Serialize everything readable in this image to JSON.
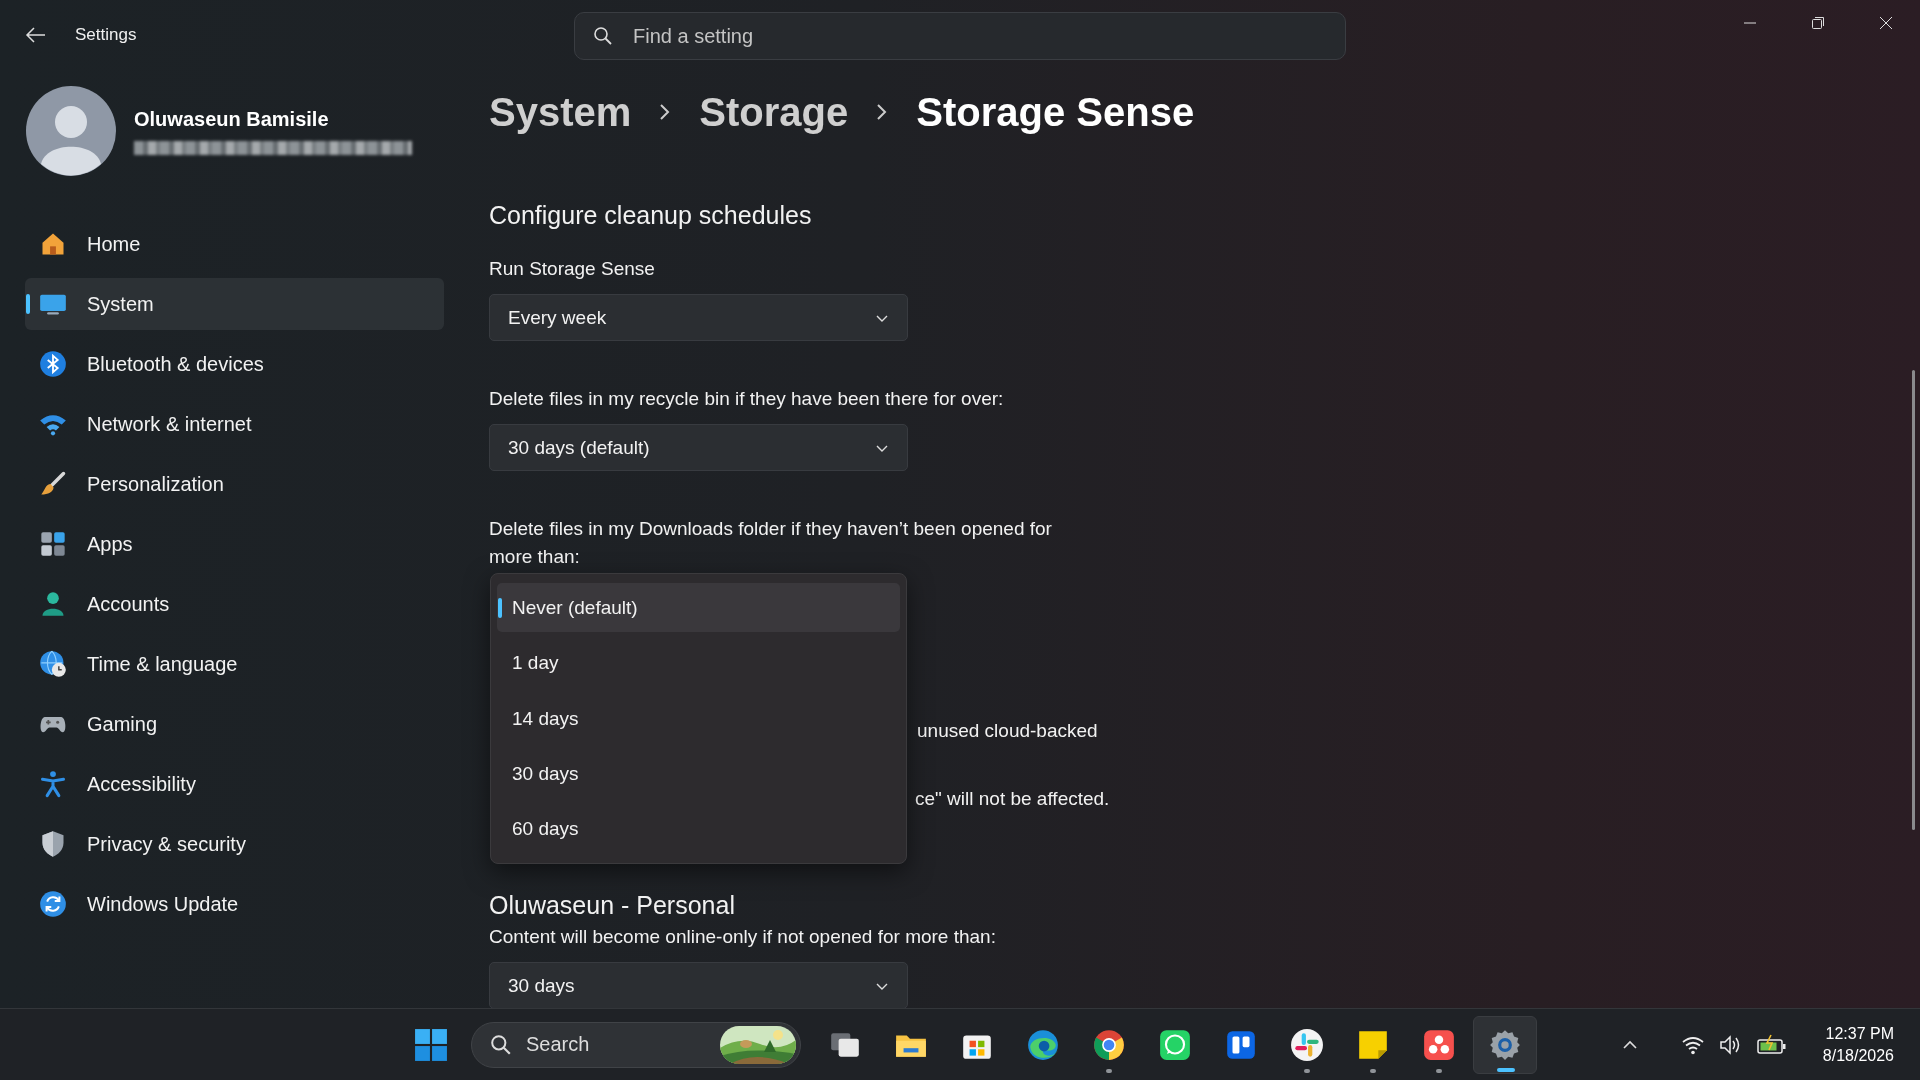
{
  "window": {
    "title": "Settings"
  },
  "search": {
    "placeholder": "Find a setting"
  },
  "profile": {
    "name": "Oluwaseun Bamisile"
  },
  "sidebar": {
    "items": [
      {
        "label": "Home",
        "selected": false
      },
      {
        "label": "System",
        "selected": true
      },
      {
        "label": "Bluetooth & devices",
        "selected": false
      },
      {
        "label": "Network & internet",
        "selected": false
      },
      {
        "label": "Personalization",
        "selected": false
      },
      {
        "label": "Apps",
        "selected": false
      },
      {
        "label": "Accounts",
        "selected": false
      },
      {
        "label": "Time & language",
        "selected": false
      },
      {
        "label": "Gaming",
        "selected": false
      },
      {
        "label": "Accessibility",
        "selected": false
      },
      {
        "label": "Privacy & security",
        "selected": false
      },
      {
        "label": "Windows Update",
        "selected": false
      }
    ]
  },
  "breadcrumb": [
    "System",
    "Storage",
    "Storage Sense"
  ],
  "cleanup": {
    "heading": "Configure cleanup schedules",
    "run_label": "Run Storage Sense",
    "run_value": "Every week",
    "recycle_label": "Delete files in my recycle bin if they have been there for over:",
    "recycle_value": "30 days (default)",
    "downloads_label": "Delete files in my Downloads folder if they haven’t been opened for more than:",
    "downloads_options": [
      {
        "label": "Never (default)",
        "selected": true
      },
      {
        "label": "1 day",
        "selected": false
      },
      {
        "label": "14 days",
        "selected": false
      },
      {
        "label": "30 days",
        "selected": false
      },
      {
        "label": "60 days",
        "selected": false
      }
    ],
    "covered_lines": [
      "unused cloud-backed",
      "ce\" will not be affected."
    ]
  },
  "onedrive": {
    "heading": "Oluwaseun - Personal",
    "label": "Content will become online-only if not opened for more than:",
    "value": "30 days"
  },
  "taskbar": {
    "search_label": "Search",
    "apps": [
      {
        "running": false,
        "selected": false
      },
      {
        "running": false,
        "selected": false
      },
      {
        "running": false,
        "selected": false
      },
      {
        "running": false,
        "selected": false
      },
      {
        "running": true,
        "selected": false
      },
      {
        "running": false,
        "selected": false
      },
      {
        "running": false,
        "selected": false
      },
      {
        "running": true,
        "selected": false
      },
      {
        "running": true,
        "selected": false
      },
      {
        "running": true,
        "selected": false
      },
      {
        "running": true,
        "selected": true
      }
    ],
    "time": "12:37 PM",
    "date": "8/18/2026"
  }
}
